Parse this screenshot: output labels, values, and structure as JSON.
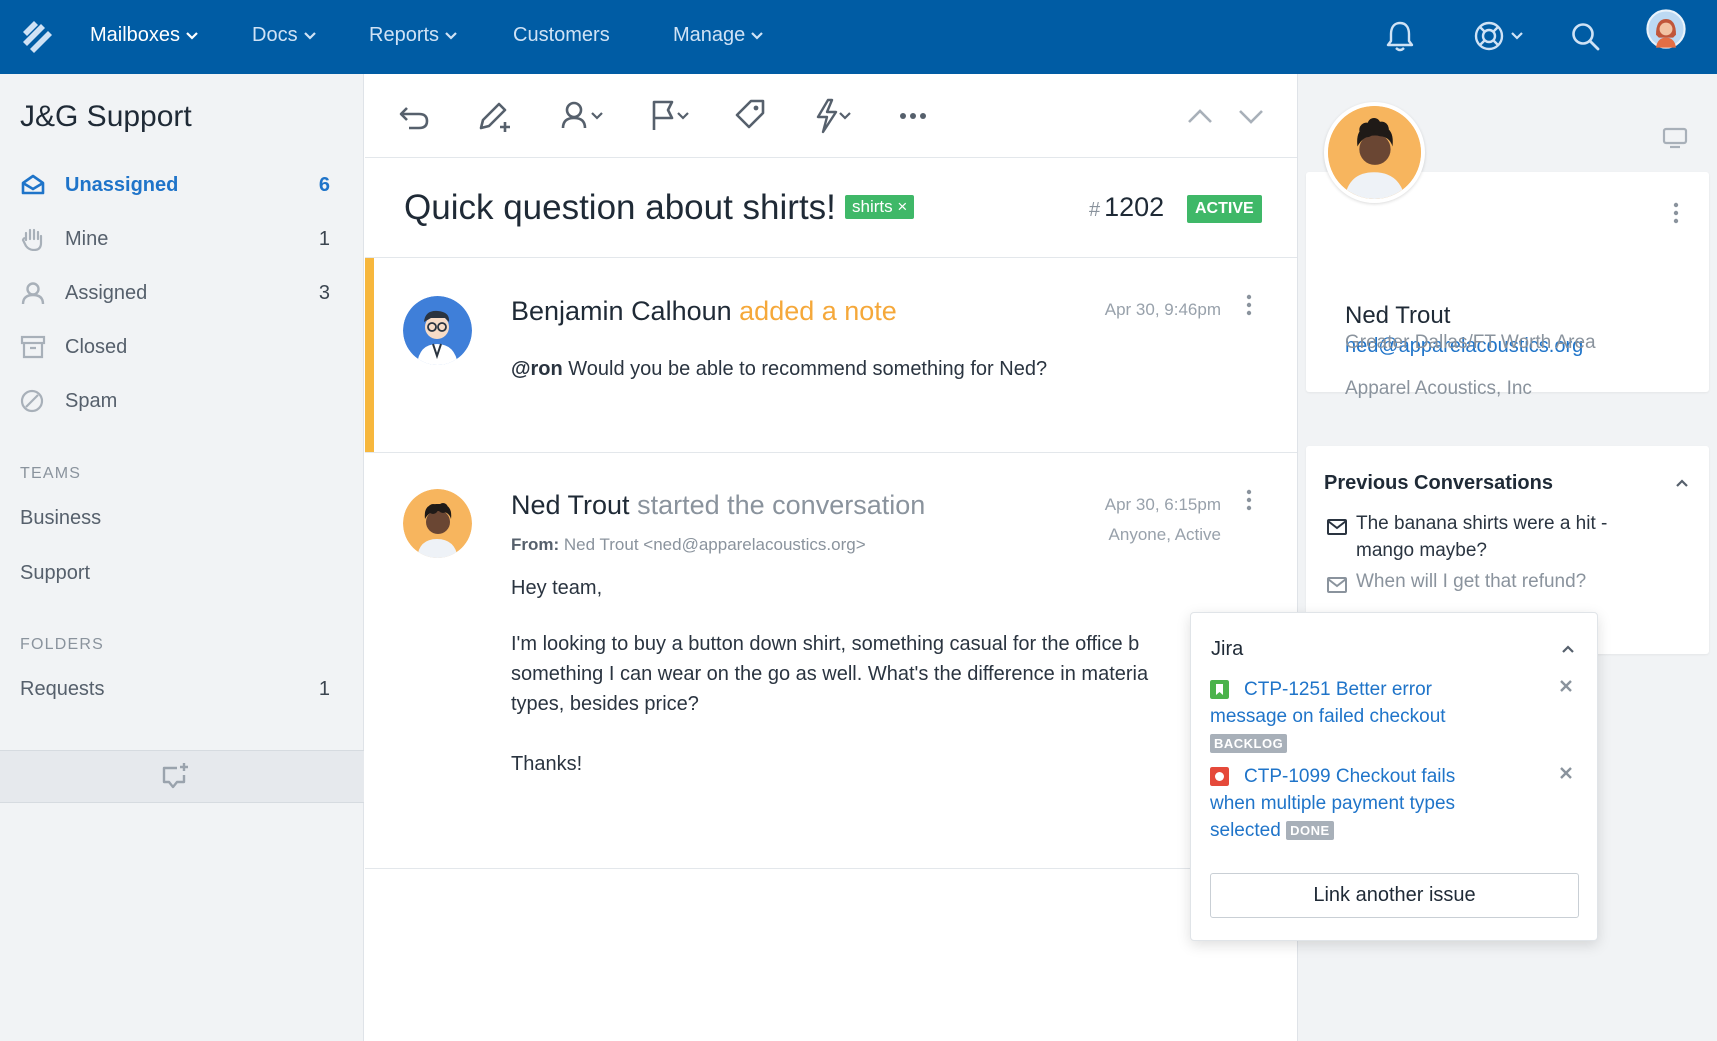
{
  "nav": {
    "items": [
      {
        "label": "Mailboxes",
        "dropdown": true,
        "active": true
      },
      {
        "label": "Docs",
        "dropdown": true
      },
      {
        "label": "Reports",
        "dropdown": true
      },
      {
        "label": "Customers",
        "dropdown": false
      },
      {
        "label": "Manage",
        "dropdown": true
      }
    ],
    "icons": [
      "logo-icon",
      "bell-icon",
      "help-icon",
      "search-icon",
      "user-avatar"
    ],
    "bg_color": "#005ca4"
  },
  "sidebar": {
    "mailbox_title": "J&G Support",
    "folders": [
      {
        "label": "Unassigned",
        "count": "6",
        "icon": "inbox-icon",
        "active": true
      },
      {
        "label": "Mine",
        "count": "1",
        "icon": "hand-icon"
      },
      {
        "label": "Assigned",
        "count": "3",
        "icon": "person-icon"
      },
      {
        "label": "Closed",
        "count": "",
        "icon": "archive-icon"
      },
      {
        "label": "Spam",
        "count": "",
        "icon": "spam-icon"
      }
    ],
    "teams_heading": "TEAMS",
    "teams": [
      "Business",
      "Support"
    ],
    "folders_heading": "FOLDERS",
    "custom_folders": [
      {
        "label": "Requests",
        "count": "1"
      }
    ]
  },
  "toolbar": {
    "icons": [
      "undo-icon",
      "add-note-icon",
      "assign-icon",
      "flag-icon",
      "tag-icon",
      "workflow-icon",
      "more-icon",
      "prev-icon",
      "next-icon"
    ]
  },
  "conversation": {
    "subject": "Quick question about shirts!",
    "tag": "shirts ×",
    "number_hash": "#",
    "number": "1202",
    "status": "ACTIVE",
    "threads": [
      {
        "author": "Benjamin Calhoun",
        "action": "added a note",
        "time": "Apr 30, 9:46pm",
        "mention": "@ron",
        "body": "Would you be able to recommend something for Ned?"
      },
      {
        "author": "Ned Trout",
        "action": "started the conversation",
        "time": "Apr 30, 6:15pm",
        "assignment": "Anyone, Active",
        "from_label": "From:",
        "from_value": "Ned Trout <ned@apparelacoustics.org>",
        "greeting": "Hey team,",
        "line1": "I'm looking to buy a button down shirt, something casual for the office b",
        "line2": "something I can wear on the go as well. What's the difference in materia",
        "line3": "types, besides price?",
        "signoff": "Thanks!"
      }
    ]
  },
  "customer": {
    "name": "Ned Trout",
    "email": "ned@apparelacoustics.org",
    "company": "Apparel Acoustics, Inc",
    "location": "Greater Dallas/FT Worth Area"
  },
  "previous_conversations": {
    "title": "Previous Conversations",
    "items": [
      {
        "line1": "The banana shirts were a hit -",
        "line2": "mango maybe?"
      },
      {
        "line1": "When will I get that refund?"
      }
    ]
  },
  "jira": {
    "title": "Jira",
    "issues": [
      {
        "line1": "CTP-1251 Better error",
        "line2": "message on failed checkout",
        "status": "BACKLOG",
        "badge_color": "#4bb34b"
      },
      {
        "line1": "CTP-1099 Checkout fails",
        "line2": "when multiple payment types",
        "line3": "selected",
        "status": "DONE",
        "badge_color": "#e5493a"
      }
    ],
    "link_button": "Link another issue"
  },
  "colors": {
    "accent_blue": "#1f74c9",
    "green": "#3fb868",
    "note_yellow": "#f7b73d"
  }
}
